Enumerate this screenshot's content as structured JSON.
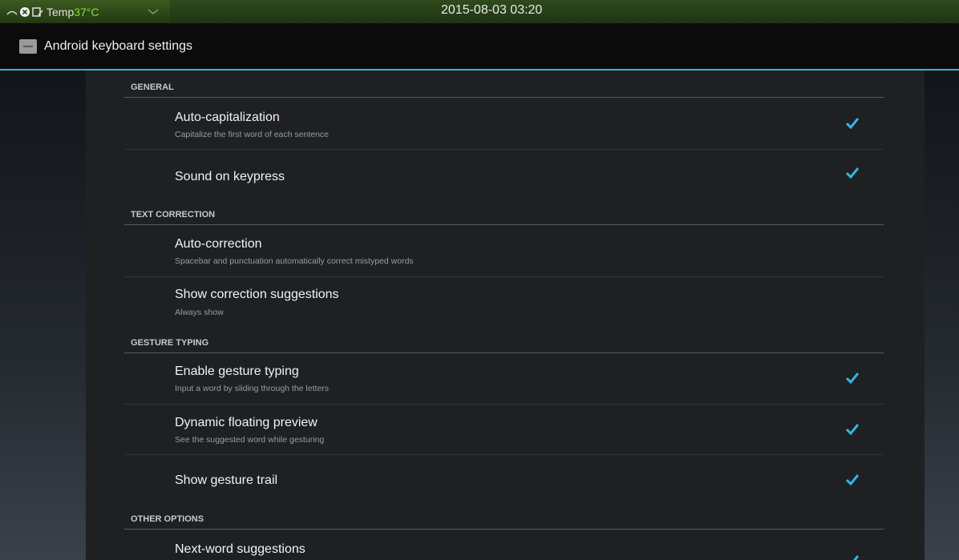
{
  "status_bar": {
    "icons": [
      "signal-icon",
      "close-circle-icon",
      "phone-icon"
    ],
    "temp_label": "Temp",
    "temp_value": "37°C",
    "datetime": "2015-08-03 03:20"
  },
  "action_bar": {
    "title": "Android keyboard settings",
    "accent_color": "#33b5e5"
  },
  "sections": {
    "general": {
      "title": "GENERAL"
    },
    "text_correction": {
      "title": "TEXT CORRECTION"
    },
    "gesture_typing": {
      "title": "GESTURE TYPING"
    },
    "other_options": {
      "title": "OTHER OPTIONS"
    }
  },
  "prefs": {
    "auto_capitalization": {
      "title": "Auto-capitalization",
      "summary": "Capitalize the first word of each sentence",
      "checked": true
    },
    "sound_on_keypress": {
      "title": "Sound on keypress",
      "checked": true
    },
    "auto_correction": {
      "title": "Auto-correction",
      "summary": "Spacebar and punctuation automatically correct mistyped words"
    },
    "show_correction_suggestions": {
      "title": "Show correction suggestions",
      "summary": "Always show"
    },
    "enable_gesture_typing": {
      "title": "Enable gesture typing",
      "summary": "Input a word by sliding through the letters",
      "checked": true
    },
    "dynamic_floating_preview": {
      "title": "Dynamic floating preview",
      "summary": "See the suggested word while gesturing",
      "checked": true
    },
    "show_gesture_trail": {
      "title": "Show gesture trail",
      "checked": true
    },
    "next_word_suggestions": {
      "title": "Next-word suggestions",
      "checked": true
    }
  },
  "colors": {
    "checkmark": "#33b5e5",
    "temp_value": "#8dde3a"
  }
}
